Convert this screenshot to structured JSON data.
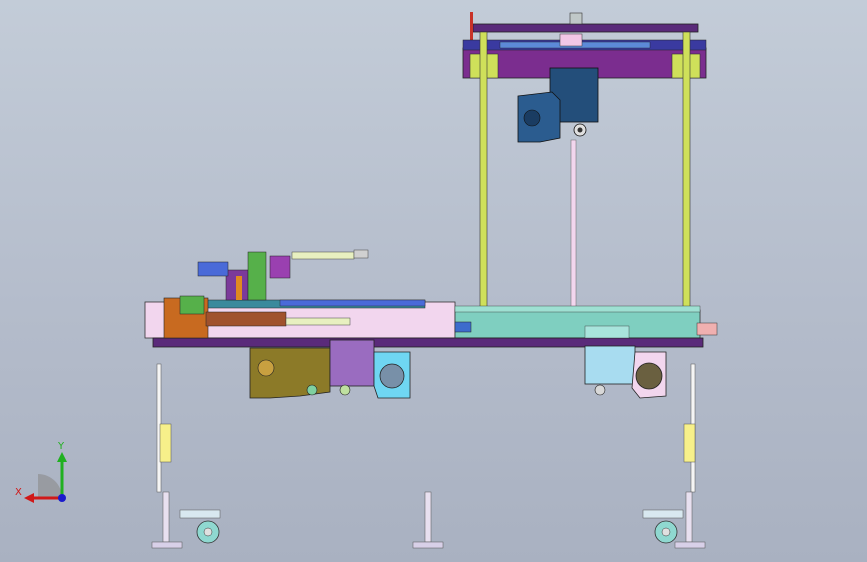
{
  "view": {
    "background_top": "#c3ccd8",
    "background_bottom": "#a9b1c1"
  },
  "triad": {
    "x_label": "X",
    "y_label": "Y",
    "x_color": "#d01818",
    "y_color": "#20b020",
    "z_color": "#1a1acc"
  },
  "colors": {
    "frame_purple": "#7b2d8f",
    "deck_violet": "#5a2a7a",
    "column_yellow": "#cfe05a",
    "plate_teal": "#7fcfc0",
    "plate_pink": "#f2d6ee",
    "motor_blue": "#234e7a",
    "bracket_olive": "#8c7a28",
    "bracket_lavender": "#9a6cc0",
    "box_cyan": "#6fd6f2",
    "box_lightblue": "#a8dcf0",
    "leg_white": "#f5f5f5",
    "wheel_teal": "#8fd8d0"
  }
}
